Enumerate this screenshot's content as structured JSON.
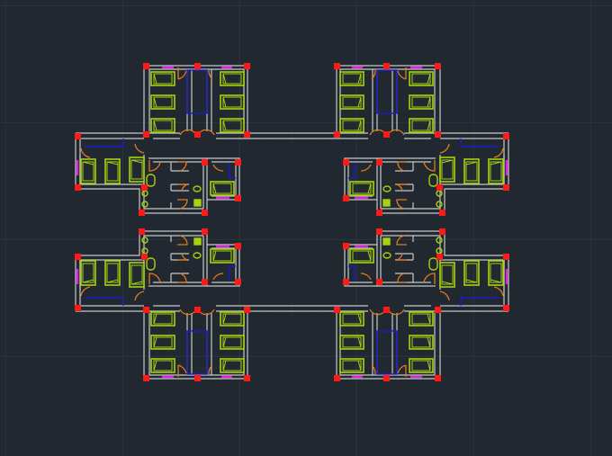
{
  "drawing": {
    "type": "cad-floor-plan",
    "modules": [
      "top-left",
      "top-right",
      "bottom-left",
      "bottom-right"
    ],
    "colors": {
      "background": "#212830",
      "grid_minor": "#262d36",
      "grid_major": "#2f3742",
      "wall": "#c8c8c8",
      "column": "#ff1a1a",
      "furniture": "#a6d20f",
      "door": "#e07a1e",
      "window": "#e020e0",
      "blue_line": "#1a1ad0"
    }
  }
}
